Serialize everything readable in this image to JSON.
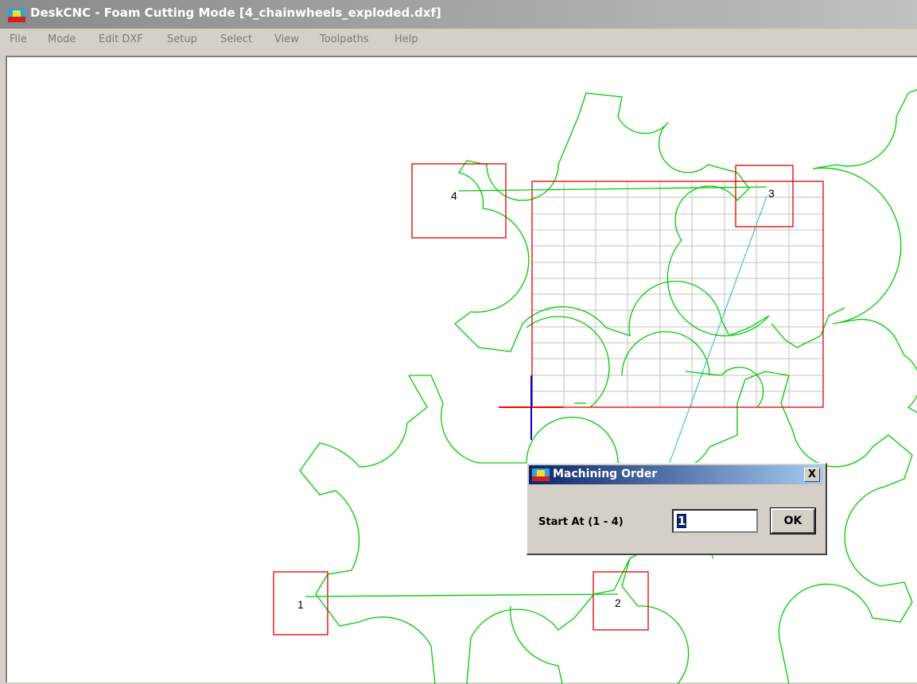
{
  "window": {
    "title": "DeskCNC - Foam Cutting Mode [4_chainwheels_exploded.dxf]",
    "icon": "deskcnc-app-icon"
  },
  "menu": {
    "items": [
      "File",
      "Mode",
      "Edit DXF",
      "Setup",
      "Select",
      "View",
      "Toolpaths",
      "Help"
    ]
  },
  "canvas": {
    "markers": [
      "1",
      "2",
      "3",
      "4"
    ],
    "colors": {
      "geometry": "#00cc00",
      "selection_box": "#e00000",
      "grid": "#c0c0c0",
      "path": "#00b0a0",
      "axis_x": "#ff0000",
      "axis_y": "#0000cc"
    }
  },
  "dialog": {
    "title": "Machining Order",
    "close_label": "X",
    "start_label": "Start At (1 - 4)",
    "start_value": "1",
    "ok_label": "OK"
  }
}
